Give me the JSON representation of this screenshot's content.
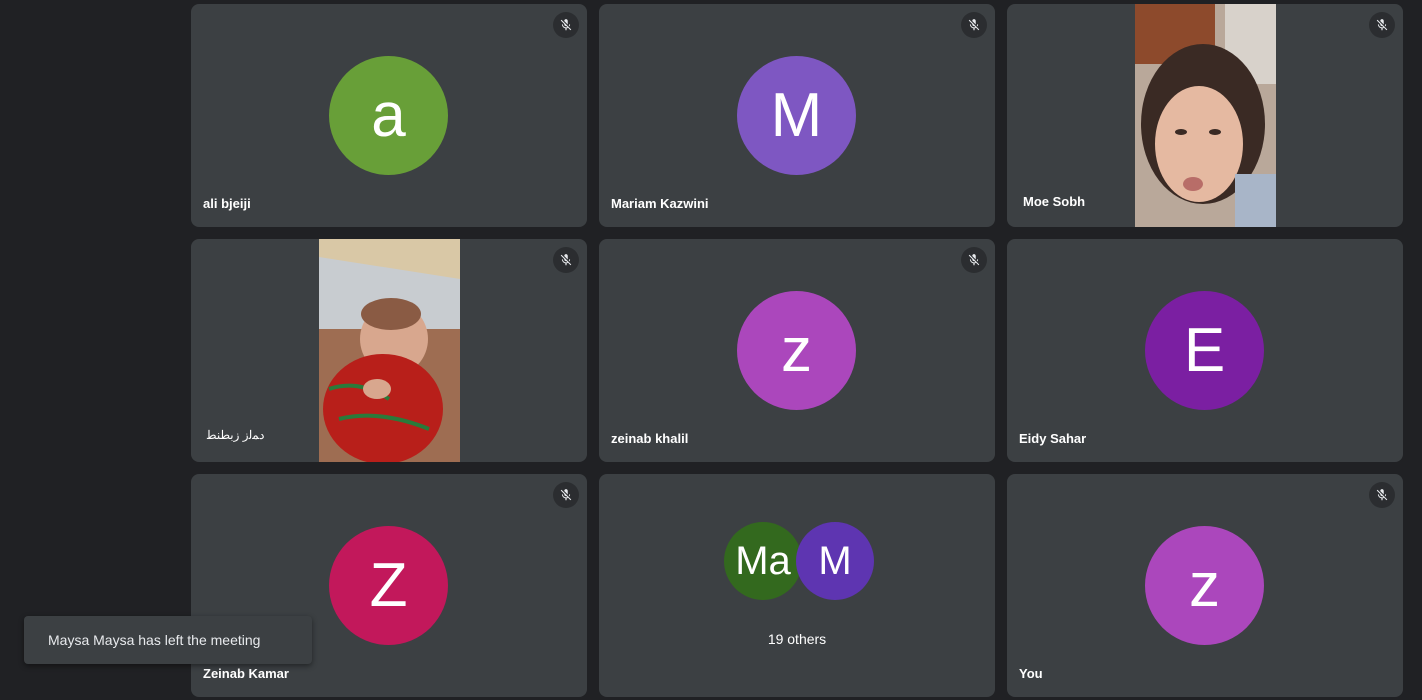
{
  "tiles": [
    {
      "name": "ali bjeiji",
      "initial": "a",
      "avatar_color": "#689f38",
      "muted": true,
      "has_video": false
    },
    {
      "name": "Mariam Kazwini",
      "initial": "M",
      "avatar_color": "#7e57c2",
      "muted": true,
      "has_video": false
    },
    {
      "name": "Moe Sobh",
      "initial": "",
      "avatar_color": "",
      "muted": true,
      "has_video": true
    },
    {
      "name": "ﺩﻤﻟﺯ ﺯﺑﻄﻨﻄ",
      "initial": "",
      "avatar_color": "",
      "muted": true,
      "has_video": true
    },
    {
      "name": "zeinab khalil",
      "initial": "z",
      "avatar_color": "#ab47bc",
      "muted": true,
      "has_video": false
    },
    {
      "name": "Eidy Sahar",
      "initial": "E",
      "avatar_color": "#7b1fa2",
      "muted": false,
      "has_video": false
    },
    {
      "name": "Zeinab Kamar",
      "initial": "Z",
      "avatar_color": "#c2185b",
      "muted": true,
      "has_video": false
    },
    {
      "name": "You",
      "initial": "z",
      "avatar_color": "#ab47bc",
      "muted": true,
      "has_video": false
    }
  ],
  "others": {
    "label": "19 others",
    "avatars": [
      {
        "initial": "Ma",
        "color": "#33691e"
      },
      {
        "initial": "M",
        "color": "#5e35b1"
      }
    ]
  },
  "toast": {
    "message": "Maysa Maysa has left the meeting"
  },
  "icons": {
    "mic": "mic-off-icon"
  },
  "colors": {
    "background": "#202124",
    "tile": "#3c4043"
  }
}
